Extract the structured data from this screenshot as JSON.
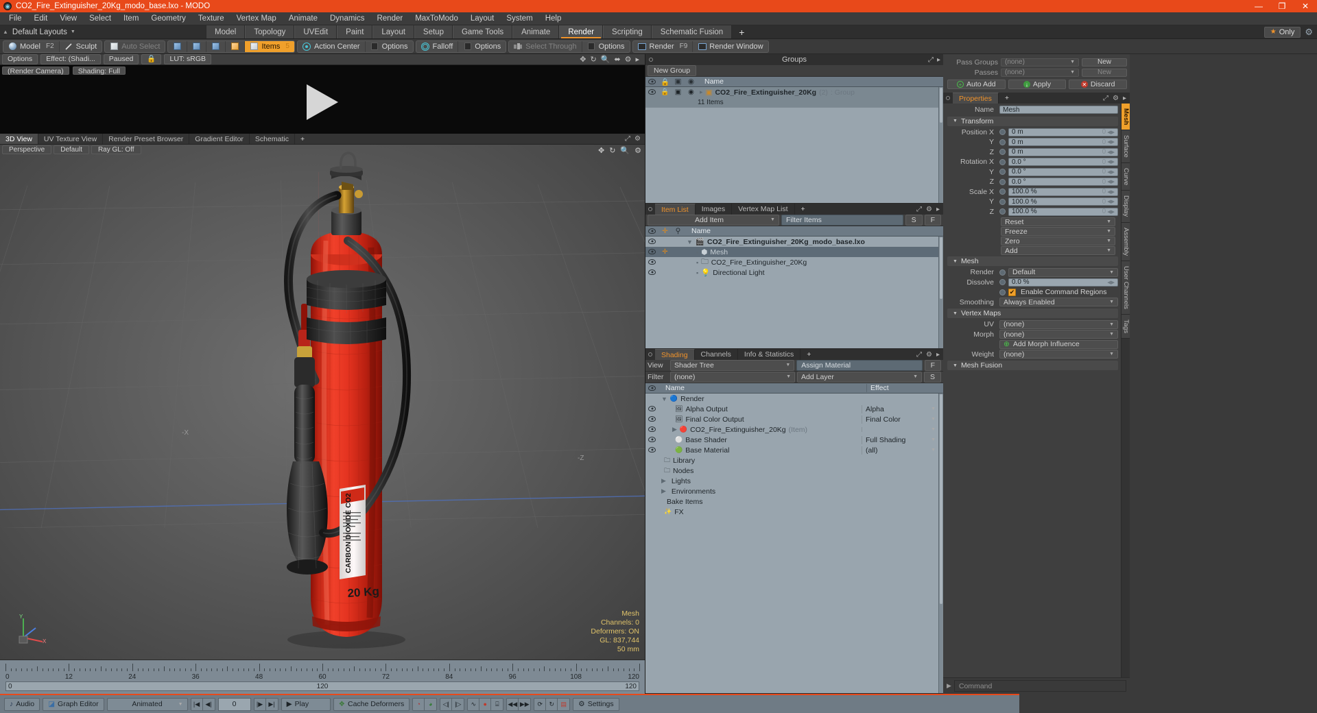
{
  "titlebar": {
    "title": "CO2_Fire_Extinguisher_20Kg_modo_base.lxo - MODO",
    "app_icon": "modo-logo-icon",
    "minimize": "—",
    "maximize": "❐",
    "close": "✕"
  },
  "menubar": {
    "items": [
      "File",
      "Edit",
      "View",
      "Select",
      "Item",
      "Geometry",
      "Texture",
      "Vertex Map",
      "Animate",
      "Dynamics",
      "Render",
      "MaxToModo",
      "Layout",
      "System",
      "Help"
    ]
  },
  "layoutrow": {
    "layouts_label": "Default Layouts",
    "tabs": [
      "Model",
      "Topology",
      "UVEdit",
      "Paint",
      "Layout",
      "Setup",
      "Game Tools",
      "Animate",
      "Render",
      "Scripting",
      "Schematic Fusion"
    ],
    "active_tab": "Render",
    "plus": "+",
    "only_label": "Only",
    "star": "★"
  },
  "modebar": {
    "mode_model": "Model",
    "mode_model_hotkey": "F2",
    "mode_sculpt": "Sculpt",
    "auto_select": "Auto Select",
    "items": "Items",
    "items_hotkey": "5",
    "action_center": "Action Center",
    "options_1": "Options",
    "falloff": "Falloff",
    "options_2": "Options",
    "select_through": "Select Through",
    "options_3": "Options",
    "render": "Render",
    "render_hotkey": "F9",
    "render_window": "Render Window"
  },
  "preview": {
    "options": "Options",
    "effect": "Effect: (Shadi...",
    "paused": "Paused",
    "lut": "LUT: sRGB",
    "camera": "(Render Camera)",
    "shading": "Shading: Full"
  },
  "viewport_tabs": {
    "tabs": [
      "3D View",
      "UV Texture View",
      "Render Preset Browser",
      "Gradient Editor",
      "Schematic"
    ],
    "active": "3D View",
    "plus": "+"
  },
  "viewport": {
    "buttons": [
      "Perspective",
      "Default",
      "Ray GL: Off"
    ],
    "stats_title": "Mesh",
    "stats": [
      "Channels: 0",
      "Deformers: ON",
      "GL: 837,744",
      "50 mm"
    ],
    "axis_labels": {
      "x": "X",
      "y": "Y",
      "z": "Z",
      "neg_z": "-Z",
      "neg_x": "-X"
    },
    "extinguisher_label_title": "CARBON DIOXIDE CO2",
    "extinguisher_weight": "20 Kg"
  },
  "timeline": {
    "ticks": [
      "0",
      "12",
      "24",
      "36",
      "48",
      "60",
      "72",
      "84",
      "96",
      "108",
      "120"
    ],
    "range_start": "0",
    "range_mid": "120",
    "range_end": "120"
  },
  "groups_panel": {
    "title": "Groups",
    "new_group_button": "New Group",
    "col_name": "Name",
    "rows": [
      {
        "name": "CO2_Fire_Extinguisher_20Kg",
        "count": "(2)",
        "kind": ": Group",
        "sub": "11 Items"
      }
    ]
  },
  "item_list_panel": {
    "tabs": [
      "Item List",
      "Images",
      "Vertex Map List"
    ],
    "active_tab": "Item List",
    "plus": "+",
    "add_item": "Add Item",
    "filter_placeholder": "Filter Items",
    "btn_s": "S",
    "btn_f": "F",
    "col_name": "Name",
    "rows": [
      {
        "name": "CO2_Fire_Extinguisher_20Kg_modo_base.lxo",
        "icon": "scene-icon",
        "depth": 0,
        "bold": true,
        "selected": false
      },
      {
        "name": "Mesh",
        "icon": "mesh-icon",
        "depth": 1,
        "bold": false,
        "selected": true
      },
      {
        "name": "CO2_Fire_Extinguisher_20Kg",
        "icon": "group-folder-icon",
        "depth": 1,
        "bold": false,
        "selected": false
      },
      {
        "name": "Directional Light",
        "icon": "light-icon",
        "depth": 1,
        "bold": false,
        "selected": false
      }
    ]
  },
  "shading_panel": {
    "tabs": [
      "Shading",
      "Channels",
      "Info & Statistics"
    ],
    "active_tab": "Shading",
    "plus": "+",
    "view_label": "View",
    "view_value": "Shader Tree",
    "filter_label": "Filter",
    "filter_value": "(none)",
    "assign_material": "Assign Material",
    "add_layer": "Add Layer",
    "btn_f": "F",
    "btn_s": "S",
    "col_name": "Name",
    "col_effect": "Effect",
    "rows": [
      {
        "name": "Render",
        "effect": "",
        "icon": "render-sphere-icon",
        "depth": 0,
        "expander": "▼",
        "eye": false
      },
      {
        "name": "Alpha Output",
        "effect": "Alpha",
        "icon": "output-icon",
        "depth": 1,
        "eye": true
      },
      {
        "name": "Final Color Output",
        "effect": "Final Color",
        "icon": "output-icon",
        "depth": 1,
        "eye": true
      },
      {
        "name": "CO2_Fire_Extinguisher_20Kg",
        "suffix": "(Item)",
        "effect": "",
        "icon": "material-red-icon",
        "depth": 1,
        "expander": "▶",
        "eye": true
      },
      {
        "name": "Base Shader",
        "effect": "Full Shading",
        "icon": "shader-icon",
        "depth": 1,
        "eye": true
      },
      {
        "name": "Base Material",
        "effect": "(all)",
        "icon": "material-green-icon",
        "depth": 1,
        "eye": true
      },
      {
        "name": "Library",
        "effect": "",
        "icon": "library-folder-icon",
        "depth": 0,
        "eye": false
      },
      {
        "name": "Nodes",
        "effect": "",
        "icon": "nodes-folder-icon",
        "depth": 0,
        "eye": false
      },
      {
        "name": "Lights",
        "effect": "",
        "icon": "",
        "depth": 0,
        "expander": "▶",
        "eye": false
      },
      {
        "name": "Environments",
        "effect": "",
        "icon": "",
        "depth": 0,
        "expander": "▶",
        "eye": false
      },
      {
        "name": "Bake Items",
        "effect": "",
        "icon": "",
        "depth": 0,
        "eye": false
      },
      {
        "name": "FX",
        "effect": "",
        "icon": "fx-icon",
        "depth": 0,
        "eye": false
      }
    ]
  },
  "passes_panel": {
    "pass_groups_label": "Pass Groups",
    "pass_groups_value": "(none)",
    "pass_groups_new": "New",
    "passes_label": "Passes",
    "passes_value": "(none)",
    "passes_new": "New",
    "auto_add": "Auto Add",
    "apply": "Apply",
    "discard": "Discard"
  },
  "properties_panel": {
    "tabs": [
      "Properties"
    ],
    "active_tab": "Properties",
    "plus": "+",
    "name_label": "Name",
    "name_value": "Mesh",
    "sections": {
      "transform": "Transform",
      "mesh": "Mesh",
      "vertex_maps": "Vertex Maps",
      "mesh_fusion": "Mesh Fusion"
    },
    "transform": [
      {
        "label": "Position X",
        "value": "0 m"
      },
      {
        "label": "Y",
        "value": "0 m"
      },
      {
        "label": "Z",
        "value": "0 m"
      },
      {
        "label": "Rotation X",
        "value": "0.0 °"
      },
      {
        "label": "Y",
        "value": "0.0 °"
      },
      {
        "label": "Z",
        "value": "0.0 °"
      },
      {
        "label": "Scale X",
        "value": "100.0 %"
      },
      {
        "label": "Y",
        "value": "100.0 %"
      },
      {
        "label": "Z",
        "value": "100.0 %"
      }
    ],
    "transform_menus": [
      "Reset",
      "Freeze",
      "Zero",
      "Add"
    ],
    "mesh": {
      "render_label": "Render",
      "render_value": "Default",
      "dissolve_label": "Dissolve",
      "dissolve_value": "0.0 %",
      "enable_command_regions": "Enable Command Regions",
      "enable_command_regions_checked": true,
      "smoothing_label": "Smoothing",
      "smoothing_value": "Always Enabled"
    },
    "vertex_maps": [
      {
        "label": "UV",
        "value": "(none)"
      },
      {
        "label": "Morph",
        "value": "(none)"
      },
      {
        "label": "",
        "value": "Add Morph Influence"
      },
      {
        "label": "Weight",
        "value": "(none)"
      }
    ],
    "side_tabs": [
      "Mesh",
      "Surface",
      "Curve",
      "Display",
      "Assembly",
      "User Channels",
      "Tags"
    ],
    "side_active": "Mesh"
  },
  "bottombar": {
    "audio": "Audio",
    "graph_editor": "Graph Editor",
    "animated": "Animated",
    "frame_value": "0",
    "play": "Play",
    "cache_deformers": "Cache Deformers",
    "settings": "Settings",
    "command_placeholder": "Command"
  }
}
